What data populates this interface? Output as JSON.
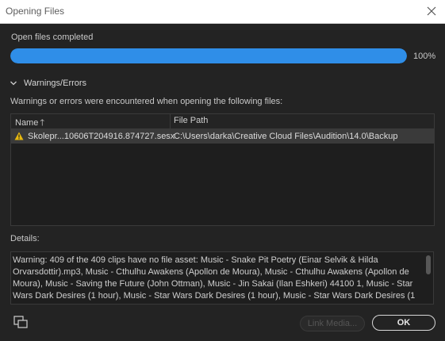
{
  "window": {
    "title": "Opening Files"
  },
  "progress": {
    "label": "Open files completed",
    "percent": 100,
    "percent_text": "100%",
    "fill_color": "#2f8ee8"
  },
  "warnings_section": {
    "header": "Warnings/Errors",
    "description": "Warnings or errors were encountered when opening the following files:"
  },
  "table": {
    "columns": [
      {
        "label": "Name",
        "sort": "ascending"
      },
      {
        "label": "File Path"
      }
    ],
    "rows": [
      {
        "status": "warning-icon",
        "name": "Skolepr...10606T204916.874727.sesx",
        "path": "C:\\Users\\darka\\Creative Cloud Files\\Audition\\14.0\\Backup"
      }
    ]
  },
  "details": {
    "label": "Details:",
    "text": "Warning: 409 of the 409 clips have no file asset: Music - Snake Pit Poetry (Einar Selvik & Hilda Orvarsdottir).mp3, Music - Cthulhu Awakens (Apollon de Moura), Music - Cthulhu Awakens (Apollon de Moura), Music - Saving the Future (John Ottman), Music - Jin Sakai (Ilan Eshkeri) 44100 1, Music - Star Wars Dark Desires (1 hour), Music - Star Wars Dark Desires (1 hour), Music - Star Wars Dark Desires (1"
  },
  "footer": {
    "link_media_label": "Link Media...",
    "ok_label": "OK"
  }
}
